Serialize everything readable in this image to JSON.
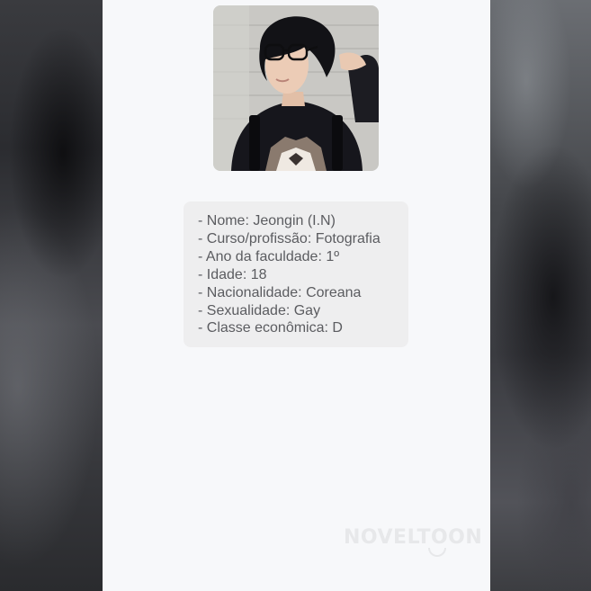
{
  "profile": {
    "fields": [
      "- Nome: Jeongin (I.N)",
      "- Curso/profissão: Fotografia",
      "- Ano da faculdade: 1º",
      "- Idade: 18",
      "- Nacionalidade: Coreana",
      "- Sexualidade: Gay",
      "- Classe econômica: D"
    ]
  },
  "watermark": "NOVELTOON",
  "icons": {
    "avatar": "profile-photo"
  },
  "colors": {
    "panel_background": "#f7f8fa",
    "card_background": "#eeeeef",
    "text": "#5b5c60"
  }
}
